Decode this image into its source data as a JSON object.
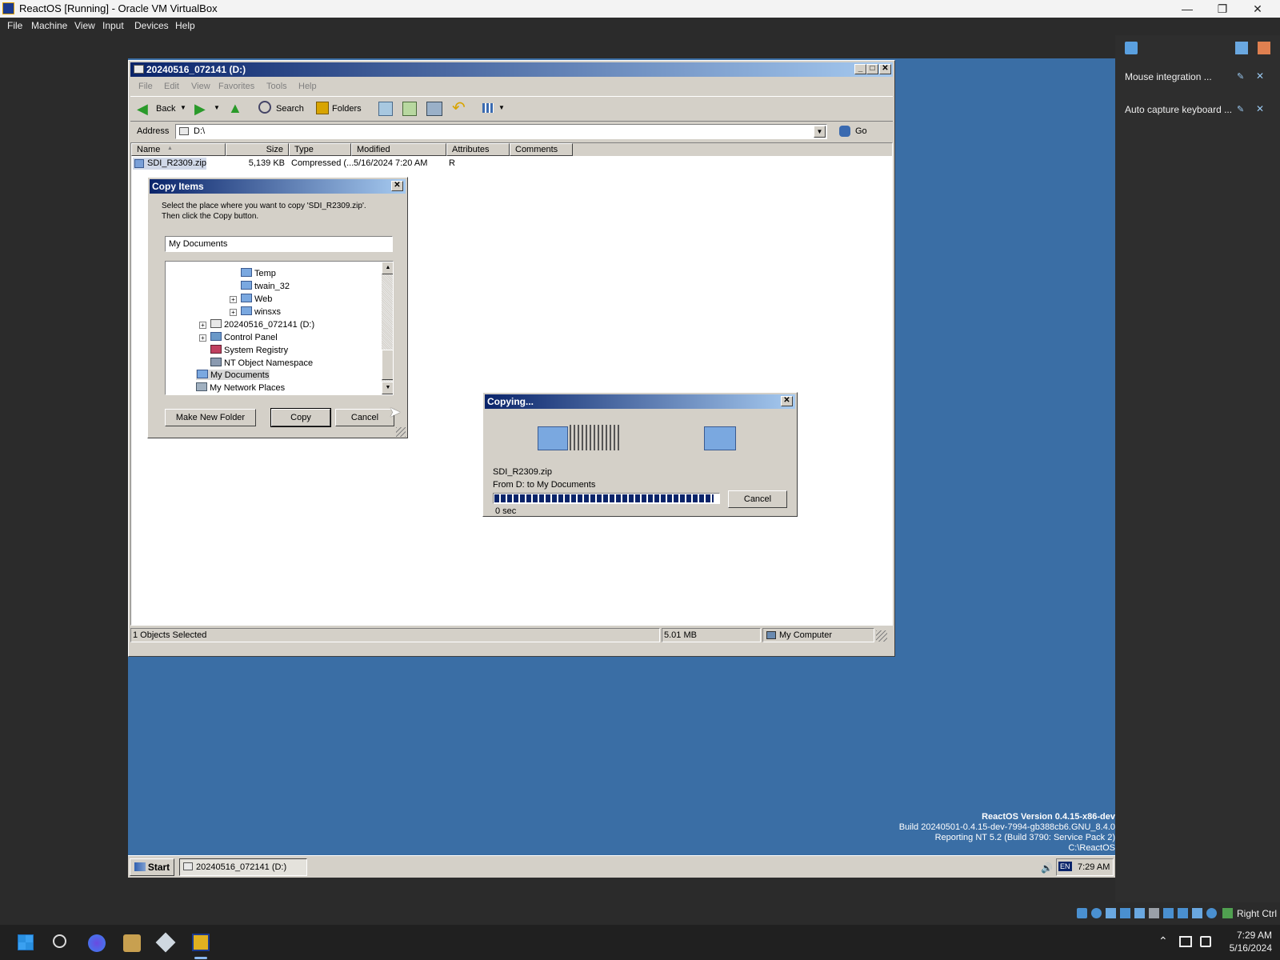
{
  "host": {
    "title": "ReactOS [Running] - Oracle VM VirtualBox",
    "menu": [
      "File",
      "Machine",
      "View",
      "Input",
      "Devices",
      "Help"
    ],
    "minimize": "—",
    "restore": "❐",
    "close": "✕"
  },
  "explorer": {
    "title": "20240516_072141 (D:)",
    "menu": [
      "File",
      "Edit",
      "View",
      "Favorites",
      "Tools",
      "Help"
    ],
    "toolbar": {
      "back": "Back",
      "search": "Search",
      "folders": "Folders"
    },
    "address_label": "Address",
    "address_value": "D:\\",
    "go": "Go",
    "columns": [
      "Name",
      "Size",
      "Type",
      "Modified",
      "Attributes",
      "Comments"
    ],
    "file": {
      "name": "SDI_R2309.zip",
      "size": "5,139 KB",
      "type": "Compressed (...",
      "modified": "5/16/2024 7:20 AM",
      "attributes": "R"
    },
    "status": {
      "selected": "1 Objects Selected",
      "size": "5.01 MB",
      "location": "My Computer"
    }
  },
  "copy_items": {
    "title": "Copy Items",
    "instruction1": "Select the place where you want to copy 'SDI_R2309.zip'.",
    "instruction2": "Then click the Copy button.",
    "path_value": "My Documents",
    "tree": [
      "Temp",
      "twain_32",
      "Web",
      "winsxs",
      "20240516_072141 (D:)",
      "Control Panel",
      "System Registry",
      "NT Object Namespace",
      "My Documents",
      "My Network Places"
    ],
    "make_new_folder": "Make New Folder",
    "copy": "Copy",
    "cancel": "Cancel"
  },
  "copying": {
    "title": "Copying...",
    "filename": "SDI_R2309.zip",
    "from_to": "From D: to My Documents",
    "time_left": "0 sec",
    "cancel": "Cancel",
    "progress": 0.98
  },
  "watermark": {
    "line1": "ReactOS Version 0.4.15-x86-dev",
    "line2": "Build 20240501-0.4.15-dev-7994-gb388cb6.GNU_8.4.0",
    "line3": "Reporting NT 5.2 (Build 3790: Service Pack 2)",
    "line4": "C:\\ReactOS"
  },
  "guest_taskbar": {
    "start": "Start",
    "task": "20240516_072141 (D:)",
    "lang": "EN",
    "clock": "7:29 AM"
  },
  "vbox_panel": {
    "item1": "Mouse integration ...",
    "item2": "Auto capture keyboard ..."
  },
  "host_status": {
    "right_ctrl": "Right Ctrl"
  },
  "win11": {
    "time": "7:29 AM",
    "date": "5/16/2024"
  }
}
